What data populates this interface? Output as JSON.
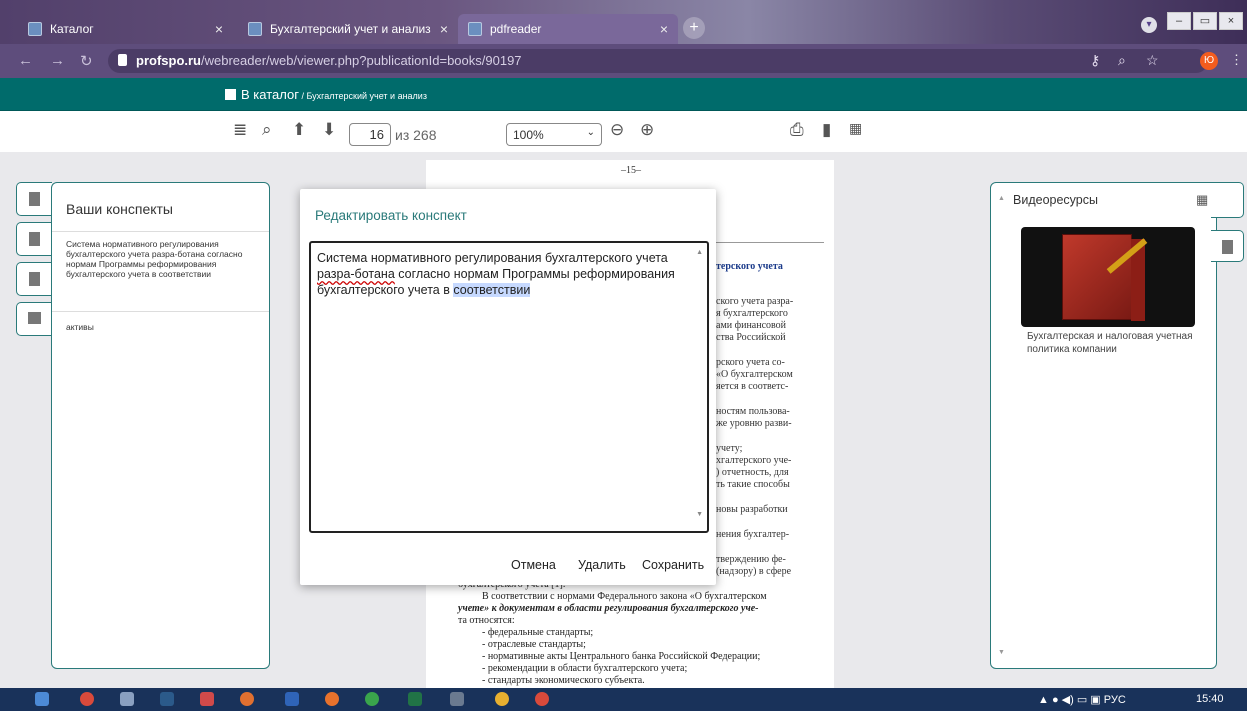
{
  "browser": {
    "tabs": [
      {
        "label": "Каталог",
        "close": "×"
      },
      {
        "label": "Бухгалтерский учет и анализ",
        "close": "×"
      },
      {
        "label": "pdfreader",
        "close": "×"
      }
    ],
    "new_tab": "+",
    "url_domain": "profspo.ru",
    "url_path": "/webreader/web/viewer.php?publicationId=books/90197",
    "avatar_letter": "Ю",
    "window_controls": [
      "–",
      "▭",
      "×"
    ]
  },
  "site": {
    "back_label": "В каталог",
    "breadcrumb": " / Бухгалтерский учет и анализ"
  },
  "toolbar": {
    "page": "16",
    "of_label": "из 268",
    "zoom": "100%"
  },
  "pdf": {
    "page_number": "–15–",
    "right_lines": [
      "терского учета",
      "ского учета разра-",
      "я бухгалтерского",
      "ами финансовой",
      "ства Российской",
      "рского учета со-",
      "«О бухгалтерском",
      "яется в соответс-",
      "ностям пользова-",
      "же уровню разви-",
      "учету;",
      "хгалтерского уче-",
      ") отчетность, для",
      "ть такие способы",
      "новы разработки",
      "нения бухгалтер-",
      "тверждению фе-",
      "(надзору) в сфере"
    ],
    "bottom_lines": [
      "бухгалтерского учета [1].",
      "В соответствии с нормами Федерального закона «О бухгалтерском",
      "учете» к документам в области регулирования бухгалтерского уче-",
      "та относятся:",
      "- федеральные стандарты;",
      "- отраслевые стандарты;",
      "- нормативные акты Центрального банка Российской Федерации;",
      "- рекомендации в области бухгалтерского учета;",
      "- стандарты экономического субъекта."
    ]
  },
  "notes_panel": {
    "title": "Ваши конспекты",
    "notes": [
      "Система нормативного регулирования бухгалтерского учета разра-ботана согласно нормам Программы реформирования бухгалтерского учета в соответствии",
      "активы"
    ]
  },
  "modal": {
    "title": "Редактировать конспект",
    "text_1": "Система нормативного регулирования бухгалтерского учета ",
    "text_spell": "разра-ботана",
    "text_2": " согласно нормам Программы реформирования бухгалтерского учета в ",
    "text_selected": "соответствии",
    "cancel": "Отмена",
    "delete": "Удалить",
    "save": "Сохранить"
  },
  "video_panel": {
    "title": "Видеоресурсы",
    "caption": "Бухгалтерская и налоговая учетная политика компании"
  },
  "taskbar": {
    "lang": "РУС",
    "time": "15:40"
  },
  "colors": {
    "site_bar": "#006b6b",
    "accent": "#2a7a7a",
    "browser": "#5e4d7c"
  }
}
